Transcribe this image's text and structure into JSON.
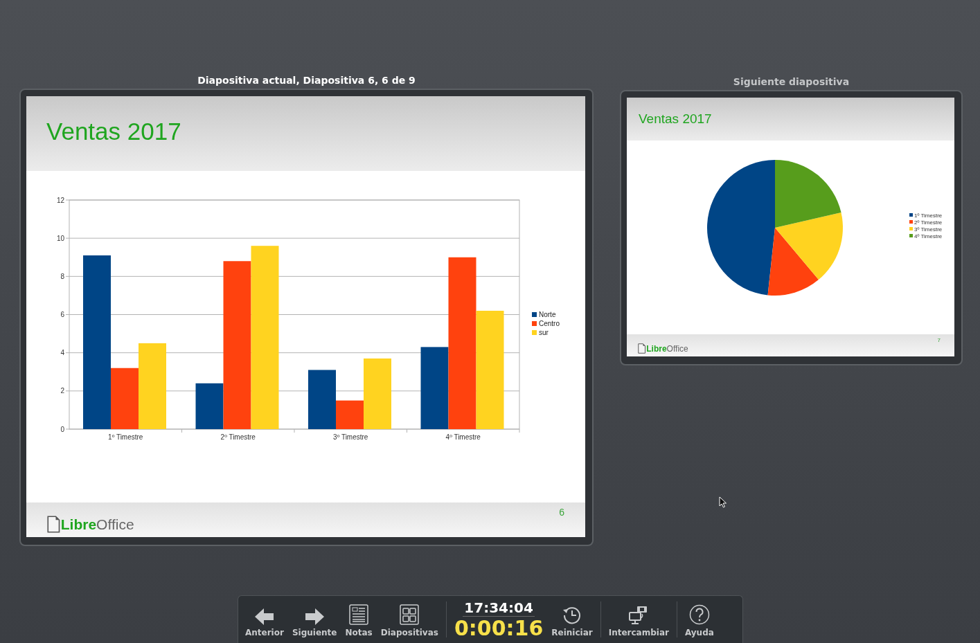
{
  "current_slide": {
    "heading": "Diapositiva actual, Diapositiva 6, 6 de 9",
    "title": "Ventas 2017",
    "logo": "**Libre**Office",
    "page_number": "6",
    "chart_data": {
      "type": "bar",
      "categories": [
        "1º Timestre",
        "2º Timestre",
        "3º Timestre",
        "4º Timestre"
      ],
      "series": [
        {
          "name": "Norte",
          "color": "#004586",
          "values": [
            9.1,
            2.4,
            3.1,
            4.3
          ]
        },
        {
          "name": "Centro",
          "color": "#ff420e",
          "values": [
            3.2,
            8.8,
            1.5,
            9.0
          ]
        },
        {
          "name": "sur",
          "color": "#ffd320",
          "values": [
            4.5,
            9.6,
            3.7,
            6.2
          ]
        }
      ],
      "ylim": [
        0,
        12
      ],
      "yticks": [
        0,
        2,
        4,
        6,
        8,
        10,
        12
      ],
      "grid": true,
      "legend": true
    }
  },
  "next_slide": {
    "heading": "Siguiente diapositiva",
    "title": "Ventas 2017",
    "logo": "**Libre**Office",
    "page_number": "7",
    "legend": [
      {
        "label": "1º Timestre",
        "color": "#004586"
      },
      {
        "label": "2º Timestre",
        "color": "#ff420e"
      },
      {
        "label": "3º Timestre",
        "color": "#ffd320"
      },
      {
        "label": "4º Timestre",
        "color": "#579d1c"
      }
    ]
  },
  "toolbar": {
    "buttons": [
      {
        "kind": "previous",
        "label": "Anterior"
      },
      {
        "kind": "next",
        "label": "Siguiente"
      },
      {
        "kind": "notes",
        "label": "Notas"
      },
      {
        "kind": "slides",
        "label": "Diapositivas"
      },
      {
        "kind": "clock",
        "time": "17:34:04",
        "elapsed": "0:00:16"
      },
      {
        "kind": "restart",
        "label": "Reiniciar"
      },
      {
        "kind": "exchange",
        "label": "Intercambiar"
      },
      {
        "kind": "help",
        "label": "Ayuda"
      }
    ]
  }
}
